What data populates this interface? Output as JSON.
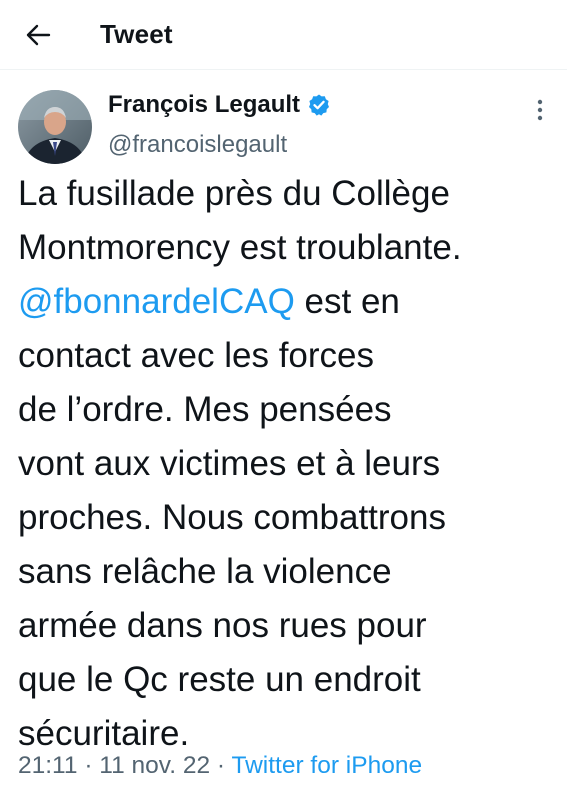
{
  "header": {
    "title": "Tweet",
    "back_icon": "arrow-left-icon"
  },
  "author": {
    "name": "François Legault",
    "handle": "@francoislegault",
    "verified_icon": "verified-badge-icon",
    "verified_color": "#1d9bf0"
  },
  "tweet": {
    "lines": [
      "La fusillade près du Collège",
      "Montmorency est troublante.",
      "est en",
      "contact avec les forces",
      "de l’ordre. Mes pensées",
      "vont aux victimes et à leurs",
      "proches. Nous combattrons",
      "sans relâche la violence",
      "armée dans nos rues pour",
      "que le Qc reste un endroit",
      "sécuritaire."
    ],
    "mention": "@fbonnardelCAQ"
  },
  "meta": {
    "time": "21:11",
    "date": "11 nov. 22",
    "separator": "·",
    "source": "Twitter for iPhone"
  },
  "colors": {
    "link": "#1d9bf0",
    "secondary_text": "#536471",
    "primary_text": "#0f1419"
  }
}
